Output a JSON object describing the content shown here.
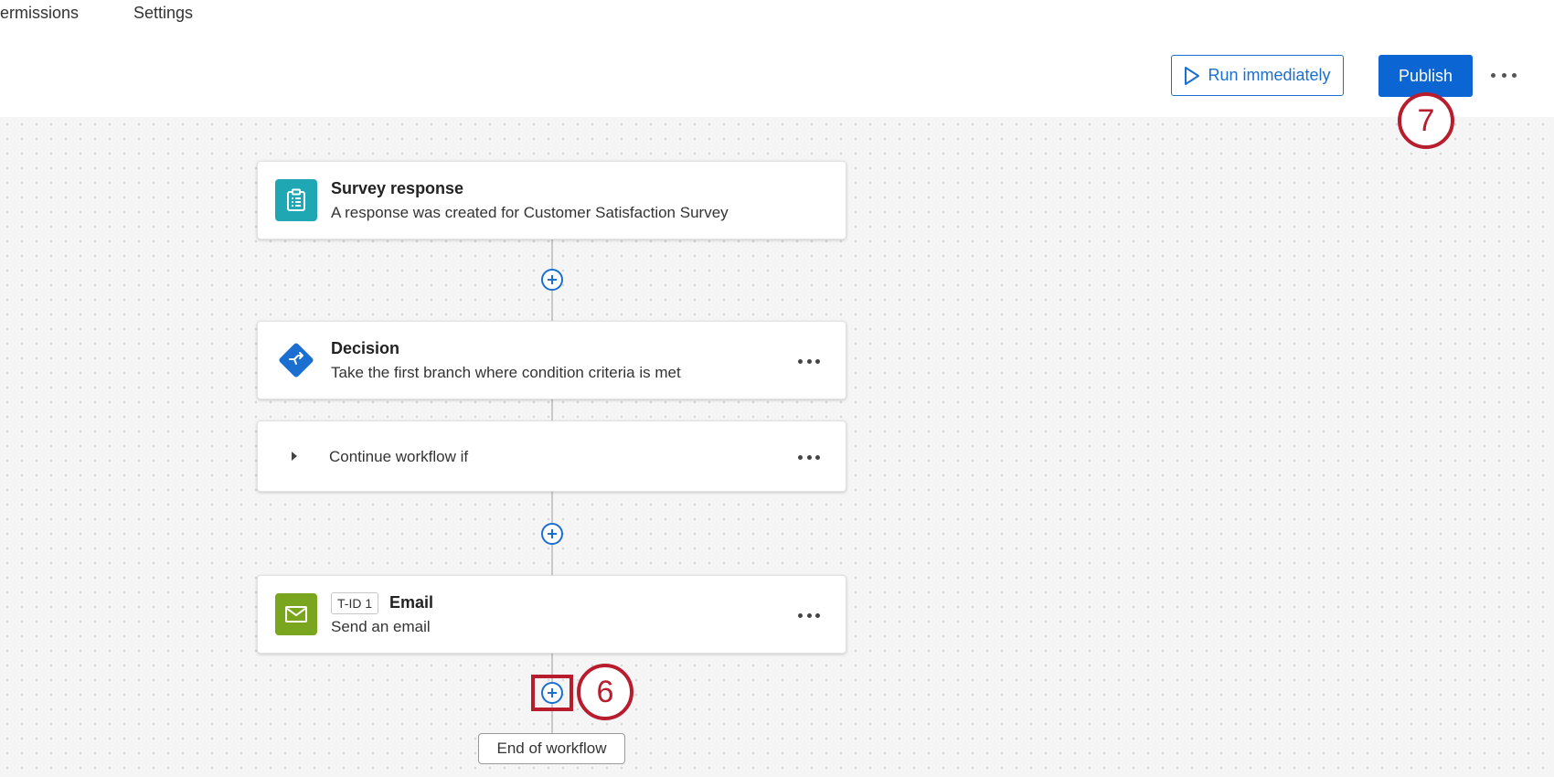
{
  "tabs": [
    {
      "label": "ermissions"
    },
    {
      "label": "Settings"
    }
  ],
  "toolbar": {
    "run_label": "Run immediately",
    "publish_label": "Publish"
  },
  "workflow": {
    "trigger": {
      "title": "Survey response",
      "subtitle": "A response was created for Customer Satisfaction Survey",
      "icon": "clipboard-icon",
      "color": "#1fa8b4"
    },
    "decision": {
      "title": "Decision",
      "subtitle": "Take the first branch where condition criteria is met",
      "icon": "decision-icon",
      "color": "#1a6fd1"
    },
    "branch": {
      "label": "Continue workflow if"
    },
    "task": {
      "tag": "T-ID 1",
      "title": "Email",
      "subtitle": "Send an email",
      "icon": "envelope-icon",
      "color": "#7aa51e"
    },
    "end_label": "End of workflow"
  },
  "callouts": {
    "publish_step": "7",
    "add_step": "6"
  },
  "colors": {
    "accent": "#0b66d4",
    "callout": "#b81d2e"
  }
}
